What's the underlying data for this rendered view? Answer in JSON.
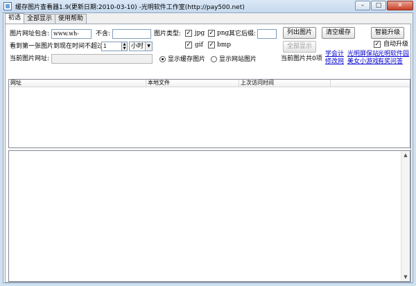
{
  "window": {
    "title": "缓存图片查看器1.9(更新日期:2010-03-10) -光明软件工作室(http://pay500.net)",
    "buttons": {
      "minimize": "–",
      "maximize": "□",
      "close": "✕"
    }
  },
  "tabs": [
    {
      "label": "初选",
      "active": true
    },
    {
      "label": "全部显示",
      "active": false
    },
    {
      "label": "使用帮助",
      "active": false
    }
  ],
  "filters": {
    "url_contains_label": "图片网址包含:",
    "url_contains_value": "www.wh-seo.com",
    "exclude_label": "不含:",
    "exclude_value": "",
    "time_label": "看到第一张图片到现在时间不超过:",
    "time_value": "1",
    "time_unit": "小时",
    "current_url_label": "当前图片网址:",
    "current_url_value": ""
  },
  "image_types": {
    "label": "图片类型:",
    "jpg": {
      "label": "jpg",
      "checked": true
    },
    "png": {
      "label": "png",
      "checked": true
    },
    "gif": {
      "label": "gif",
      "checked": true
    },
    "bmp": {
      "label": "bmp",
      "checked": true
    },
    "other_ext_label": "其它后缀:",
    "other_ext_value": ""
  },
  "buttons": {
    "list": "列出图片",
    "clear_cache": "清空缓存",
    "show_all": "全部显示",
    "smart_upgrade": "智能升级"
  },
  "auto_upgrade": {
    "label": "自动升级",
    "checked": true
  },
  "display_mode": {
    "cache_label": "显示缓存图片",
    "cache_selected": true,
    "web_label": "显示网站图片",
    "web_selected": false
  },
  "status": {
    "current_total": "当前图片共0项"
  },
  "links": [
    "学会计",
    "光明屏保站",
    "光明软件园",
    "修改网",
    "美女小游戏",
    "有奖问答"
  ],
  "list_columns": [
    "网址",
    "本地文件",
    "上次访问时间",
    ""
  ],
  "scroll": {
    "up": "▲",
    "down": "▼"
  },
  "spin": {
    "up": "▲",
    "down": "▼"
  },
  "combo_arrow": "▼",
  "check_mark": "✓"
}
